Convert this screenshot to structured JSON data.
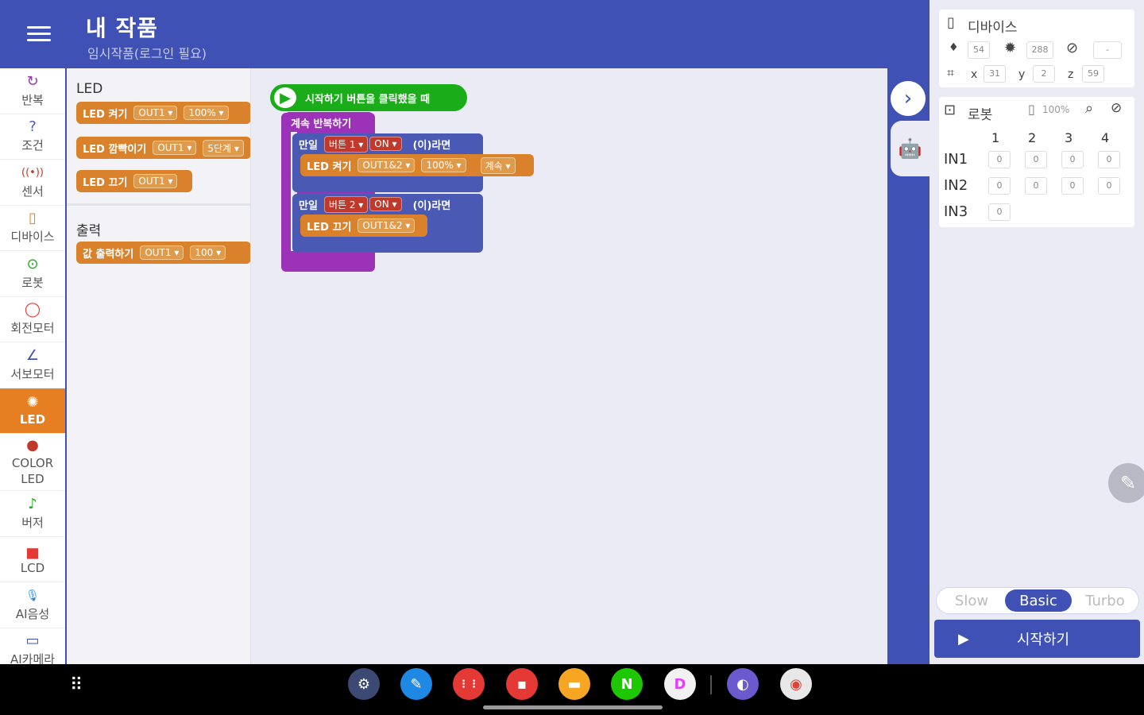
{
  "header": {
    "title": "내 작품",
    "subtitle": "임시작품(로그인 필요)"
  },
  "categories": [
    {
      "label": "반복",
      "icon": "↻"
    },
    {
      "label": "조건",
      "icon": "?"
    },
    {
      "label": "센서",
      "icon": "((•))"
    },
    {
      "label": "디바이스",
      "icon": "▯"
    },
    {
      "label": "로봇",
      "icon": "⊙"
    },
    {
      "label": "회전모터",
      "icon": "◯"
    },
    {
      "label": "서보모터",
      "icon": "∠"
    },
    {
      "label": "LED",
      "icon": "✺"
    },
    {
      "label": "COLOR LED",
      "icon": "●"
    },
    {
      "label": "버저",
      "icon": "♪"
    },
    {
      "label": "LCD",
      "icon": "▅"
    },
    {
      "label": "AI음성",
      "icon": "🎙"
    },
    {
      "label": "AI카메라",
      "icon": "▭"
    }
  ],
  "flyout": {
    "led_title": "LED",
    "output_title": "출력",
    "led_on": {
      "label": "LED 켜기",
      "port": "OUT1",
      "value": "100%"
    },
    "led_blink": {
      "label": "LED 깜빡이기",
      "port": "OUT1",
      "speed": "5단계"
    },
    "led_off": {
      "label": "LED 끄기",
      "port": "OUT1"
    },
    "output": {
      "label": "값 출력하기",
      "port": "OUT1",
      "value": "100"
    }
  },
  "script": {
    "start": "시작하기 버튼을 클릭했을 때",
    "loop": "계속 반복하기",
    "if1": {
      "keyword": "만일",
      "button": "버튼 1",
      "state": "ON",
      "then": "(이)라면"
    },
    "if1_action": {
      "label": "LED 켜기",
      "port": "OUT1&2",
      "value": "100%",
      "mode": "계속"
    },
    "if2": {
      "keyword": "만일",
      "button": "버튼 2",
      "state": "ON",
      "then": "(이)라면"
    },
    "if2_action": {
      "label": "LED 끄기",
      "port": "OUT1&2"
    }
  },
  "device_card": {
    "title": "디바이스",
    "mic": "54",
    "light": "288",
    "rotation": "-",
    "x_label": "x",
    "x": "31",
    "y_label": "y",
    "y": "2",
    "z_label": "z",
    "z": "59"
  },
  "robot_card": {
    "title": "로봇",
    "battery": "100%",
    "columns": [
      "1",
      "2",
      "3",
      "4"
    ],
    "rows": [
      {
        "label": "IN1",
        "values": [
          "0",
          "0",
          "0",
          "0"
        ]
      },
      {
        "label": "IN2",
        "values": [
          "0",
          "0",
          "0",
          "0"
        ]
      },
      {
        "label": "IN3",
        "values": [
          "0"
        ]
      }
    ]
  },
  "speed": {
    "options": [
      "Slow",
      "Basic",
      "Turbo"
    ],
    "selected": "Basic"
  },
  "run_button": "시작하기",
  "taskbar": {
    "apps": [
      {
        "name": "settings",
        "glyph": "⚙",
        "color": "#3c4a73"
      },
      {
        "name": "pen",
        "glyph": "✎",
        "color": "#1e88e5"
      },
      {
        "name": "voice-recorder",
        "glyph": "⋮⋮",
        "color": "#e53935"
      },
      {
        "name": "notes",
        "glyph": "▪",
        "color": "#e53935"
      },
      {
        "name": "files",
        "glyph": "▬",
        "color": "#f6a623"
      },
      {
        "name": "naver",
        "glyph": "N",
        "color": "#1ec800"
      },
      {
        "name": "docs",
        "glyph": "D",
        "color": "#f1f1f1"
      },
      {
        "name": "browser",
        "glyph": "◐",
        "color": "#6a5acd"
      },
      {
        "name": "chrome",
        "glyph": "◉",
        "color": "#e8e8e8"
      }
    ]
  }
}
